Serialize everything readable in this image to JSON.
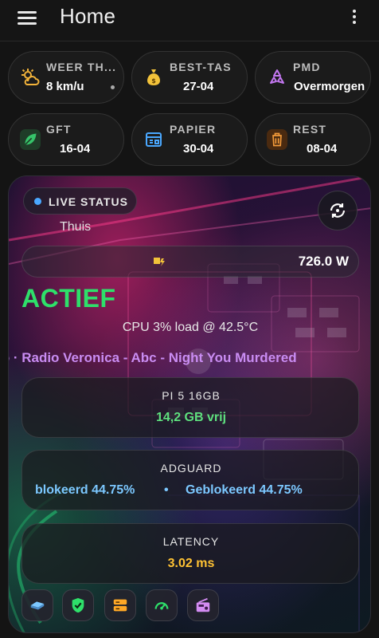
{
  "app": {
    "title": "Home"
  },
  "chips": [
    {
      "label": "WEER TH...",
      "value": "8 km/u",
      "icon": "weather-icon",
      "color": "#f2b33a"
    },
    {
      "label": "BEST-TAS",
      "value": "27-04",
      "icon": "money-bag-icon",
      "color": "#f2c23a"
    },
    {
      "label": "PMD",
      "value": "Overmorgen",
      "icon": "recycle-icon",
      "color": "#c377f0"
    },
    {
      "label": "GFT",
      "value": "16-04",
      "icon": "leaf-icon",
      "color": "#36c46a"
    },
    {
      "label": "PAPIER",
      "value": "30-04",
      "icon": "newspaper-icon",
      "color": "#4aa8ff"
    },
    {
      "label": "REST",
      "value": "08-04",
      "icon": "trash-icon",
      "color": "#f29a3a"
    }
  ],
  "status": {
    "live_label": "LIVE STATUS",
    "location": "Thuis",
    "power": "726.0 W",
    "state": "ACTIEF",
    "cpu": "CPU 3% load @ 42.5°C",
    "radio": "io · Radio Veronica - Abc - Night You Murdered"
  },
  "pi": {
    "title": "PI 5 16GB",
    "value": "14,2 GB vrij",
    "color": "#5ee07e"
  },
  "adguard": {
    "title": "ADGUARD",
    "ticker_a": "blokeerd 44.75%",
    "ticker_sep": "•",
    "ticker_b": "Geblokeerd 44.75%"
  },
  "latency": {
    "title": "LATENCY",
    "value": "3.02 ms",
    "color": "#ffc233"
  },
  "dock": [
    {
      "icon": "ethernet-icon",
      "color": "#7cc8ff"
    },
    {
      "icon": "shield-check-icon",
      "color": "#2ee06a"
    },
    {
      "icon": "server-icon",
      "color": "#ffa826"
    },
    {
      "icon": "speedometer-icon",
      "color": "#2ee06a"
    },
    {
      "icon": "radio-icon",
      "color": "#d38cf2"
    }
  ]
}
